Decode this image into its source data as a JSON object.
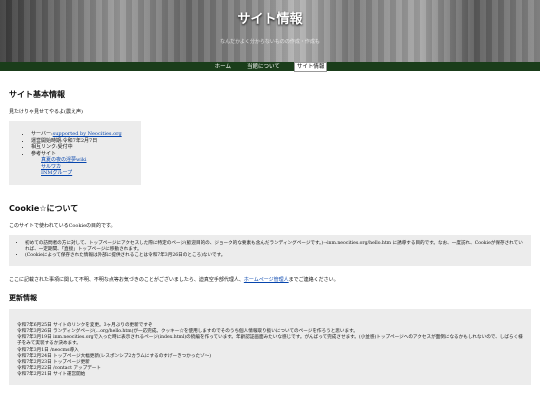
{
  "header": {
    "title": "サイト情報",
    "subtitle": "なんだかよく分からないものの作成・作成も"
  },
  "nav": {
    "items": [
      {
        "label": "ホーム"
      },
      {
        "label": "当館について"
      },
      {
        "label": "サイト情報"
      }
    ]
  },
  "basic": {
    "heading": "サイト基本情報",
    "intro": "見たけりゃ見せてやるよ(震え声)",
    "items": {
      "server_prefix": "サーバー:",
      "server_link": "supported by Neocities.org",
      "start": "運営開始時期:令和7年2月7日",
      "mutual": "相互リンク:受付中",
      "ref_label": "参考サイト",
      "refs": [
        "真夏の夜の淫夢wiki",
        "サルワカ",
        "INMグループ"
      ]
    }
  },
  "cookie": {
    "heading": "Cookie☆について",
    "intro": "このサイトで使われているCookieの目的です。",
    "items": [
      "初めての訪問者の方に対して、トップページにアクセスした際に特定のページ(歓迎目的の、ジョーク的な要素も含んだランディングページです。)→inm.neocities.org/hello.htm に誘導する目的です。なお、一度訪れ、Cookieが保存されていれば、一定期間、「直接」トップページに移動されます。",
      "(Cookieによって保存された情報は外部に提供されることは令和7年3月26日のところ)ないです。"
    ]
  },
  "contact": {
    "text": "ここに記載された事項に関して不明、不明な点等お気づきのことがございましたら、迫真空手部代理人、",
    "link": "ホームページ管理人",
    "suffix": "までご連絡ください。"
  },
  "updates": {
    "heading": "更新情報",
    "lines": [
      "令和7年6月25日 サイトのリンクを変更。3ヶ月ぶりの更新ですぞ",
      "令和7年3月26日 ランディングページ(...org/hello.htm)が一応完成。クッキー☆を使用しますのでそのうち個人情報取り扱いについてのページを作ろうと思います。",
      "令和7年3月19日 inm.neocities.orgで入った時に表示されるページ(index.html)の続編を作っています。年齢認証画面みたいな感じです。がんばって完成させます。(小並感)トップページへのアクセスが面倒になるかもしれないので、しばらく様子をみて実装するか決めます。",
      "令和7年3月1日 /neocms導入",
      "令和7年2月24日 トップページ大幅更新(レスポンシブ2カラムにするのすげーきつかったゾ〜)",
      "令和7年2月23日 トップページ更新",
      "令和7年2月22日 /contact アップデート",
      "令和7年2月21日 サイト運営開始"
    ]
  }
}
